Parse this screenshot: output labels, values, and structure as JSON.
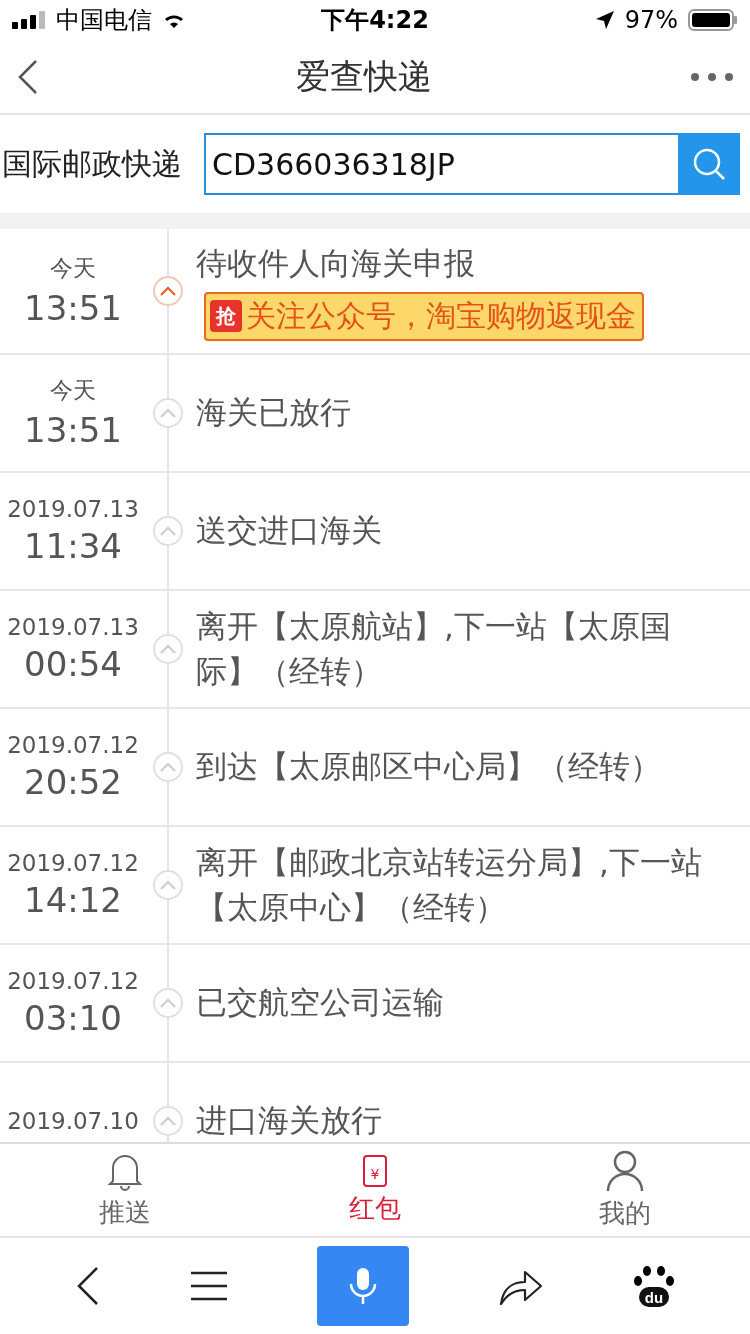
{
  "status_bar": {
    "carrier": "中国电信",
    "time": "下午4:22",
    "battery": "97%"
  },
  "nav": {
    "title": "爱查快递"
  },
  "search": {
    "company": "国际邮政快递",
    "value": "CD366036318JP"
  },
  "events": [
    {
      "date": "今天",
      "time": "13:51",
      "text": "待收件人向海关申报",
      "current": true,
      "promo": {
        "icon_char": "抢",
        "text": "关注公众号，淘宝购物返现金"
      }
    },
    {
      "date": "今天",
      "time": "13:51",
      "text": "海关已放行",
      "current": false
    },
    {
      "date": "2019.07.13",
      "time": "11:34",
      "text": "送交进口海关",
      "current": false
    },
    {
      "date": "2019.07.13",
      "time": "00:54",
      "text": "离开【太原航站】,下一站【太原国际】（经转）",
      "current": false
    },
    {
      "date": "2019.07.12",
      "time": "20:52",
      "text": "到达【太原邮区中心局】（经转）",
      "current": false
    },
    {
      "date": "2019.07.12",
      "time": "14:12",
      "text": "离开【邮政北京站转运分局】,下一站【太原中心】（经转）",
      "current": false
    },
    {
      "date": "2019.07.12",
      "time": "03:10",
      "text": "已交航空公司运输",
      "current": false
    },
    {
      "date": "2019.07.10",
      "text": "进口海关放行",
      "current": false
    }
  ],
  "tabs": [
    {
      "kind": "bell",
      "label": "推送",
      "selected": false
    },
    {
      "kind": "envelope",
      "label": "红包",
      "selected": true,
      "icon_char": "¥"
    },
    {
      "kind": "person",
      "label": "我的",
      "selected": false
    }
  ],
  "toolbar": {
    "logo_text": "du"
  }
}
